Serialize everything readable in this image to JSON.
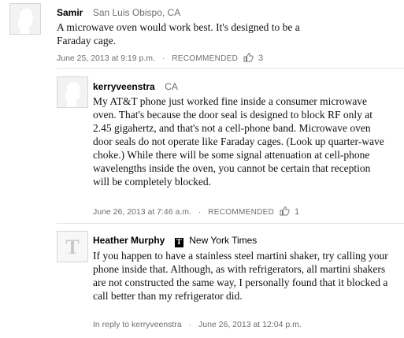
{
  "comments": [
    {
      "author": "Samir",
      "location": "San Luis Obispo, CA",
      "body": "A microwave oven would work best. It's designed to be a Faraday cage.",
      "date": "June 25, 2013 at 9:19 p.m.",
      "recommended_label": "RECOMMENDED",
      "recommend_count": "3"
    },
    {
      "author": "kerryveenstra",
      "location": "CA",
      "body": "My AT&T phone just worked fine inside a consumer microwave oven. That's because the door seal is designed to block RF only at 2.45 gigahertz, and that's not a cell-phone band. Microwave oven door seals do not operate like Faraday cages. (Look up quarter-wave choke.) While there will be some signal attenuation at cell-phone wavelengths inside the oven, you cannot be certain that reception will be completely blocked.",
      "date": "June 26, 2013 at 7:46 a.m.",
      "recommended_label": "RECOMMENDED",
      "recommend_count": "1"
    },
    {
      "author": "Heather Murphy",
      "badge": "T",
      "organization": "New York Times",
      "body": "If you happen to have a stainless steel martini shaker, try calling your phone inside that. Although, as with refrigerators, all martini shakers are not constructed the same way, I personally found that it blocked a call better than my refrigerator did.",
      "reply_to": "In reply to kerryveenstra",
      "date": "June 26, 2013 at 12:04 p.m."
    }
  ],
  "separator": "·",
  "icons": {
    "avatar": "default-avatar-icon",
    "thumb": "thumbs-up-icon",
    "nyt": "nyt-logo-icon"
  }
}
